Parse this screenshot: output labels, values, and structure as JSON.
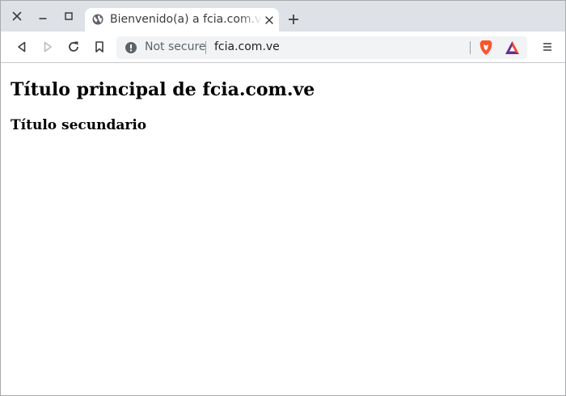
{
  "window_controls": {
    "close_icon": "close-icon",
    "minimize_icon": "minimize-icon",
    "maximize_icon": "maximize-icon"
  },
  "tab": {
    "title": "Bienvenido(a) a fcia.com.ve",
    "favicon": "globe-icon",
    "close_icon": "close-icon"
  },
  "new_tab_icon": "plus-icon",
  "toolbar": {
    "back_icon": "back-arrow-icon",
    "forward_icon": "forward-arrow-icon",
    "reload_icon": "reload-icon",
    "bookmark_icon": "bookmark-icon",
    "menu_icon": "hamburger-menu-icon"
  },
  "omnibox": {
    "security_label": "Not secure",
    "url": "fcia.com.ve"
  },
  "extensions": {
    "brave_shields_icon": "brave-lion-icon",
    "rewards_icon": "bat-triangle-icon"
  },
  "page": {
    "heading1": "Título principal de fcia.com.ve",
    "heading2": "Título secundario"
  },
  "colors": {
    "tabstrip_bg": "#dee1e6",
    "omnibox_bg": "#f1f3f4",
    "brave_orange": "#fb542b",
    "bat_purple": "#662d91",
    "bat_red": "#ff4724"
  }
}
